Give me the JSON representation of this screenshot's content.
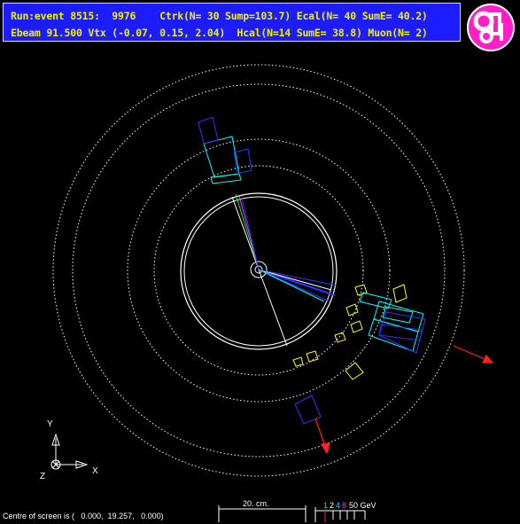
{
  "header": {
    "line1": "Run:event 8515:  9976    Ctrk(N= 30 Sump=103.7) Ecal(N= 40 SumE= 40.2)",
    "line2": "Ebeam 91.500 Vtx (-0.07, 0.15, 2.04)  Hcal(N=14 SumE= 38.8) Muon(N= 2)",
    "colors": {
      "background": "#1c1cff",
      "text": "#f2f200"
    }
  },
  "logo": {
    "text": "OPAL",
    "color": "#ff1fc7"
  },
  "axes": {
    "y_label": "Y",
    "x_label": "X",
    "z_label": "Z"
  },
  "scale": {
    "label": "20. cm."
  },
  "energy_scale": {
    "ticks": [
      {
        "text": "1",
        "color": "#00ff00"
      },
      {
        "text": "2",
        "color": "#ffffff"
      },
      {
        "text": "4",
        "color": "#33ccff"
      },
      {
        "text": "8",
        "color": "#ff33ff"
      },
      {
        "text": "50 GeV",
        "color": "#ffffff"
      }
    ]
  },
  "centre": {
    "text": "Centre of screen is (   0.000,  19.257,   0.000)"
  },
  "colors": {
    "ctrk": "#3333ff",
    "ecal": "#ffff00",
    "hcal": "#00ffff",
    "muon": "#ff2020",
    "detector": "#ffffff"
  }
}
